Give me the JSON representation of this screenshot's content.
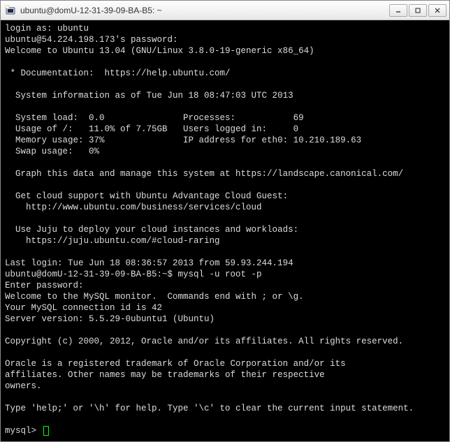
{
  "window": {
    "title": "ubuntu@domU-12-31-39-09-BA-B5: ~",
    "icon_name": "putty-icon"
  },
  "controls": {
    "minimize": "—",
    "maximize": "▢",
    "close": "✕"
  },
  "terminal": {
    "lines": [
      "login as: ubuntu",
      "ubuntu@54.224.198.173's password:",
      "Welcome to Ubuntu 13.04 (GNU/Linux 3.8.0-19-generic x86_64)",
      "",
      " * Documentation:  https://help.ubuntu.com/",
      "",
      "  System information as of Tue Jun 18 08:47:03 UTC 2013",
      "",
      "  System load:  0.0               Processes:           69",
      "  Usage of /:   11.0% of 7.75GB   Users logged in:     0",
      "  Memory usage: 37%               IP address for eth0: 10.210.189.63",
      "  Swap usage:   0%",
      "",
      "  Graph this data and manage this system at https://landscape.canonical.com/",
      "",
      "  Get cloud support with Ubuntu Advantage Cloud Guest:",
      "    http://www.ubuntu.com/business/services/cloud",
      "",
      "  Use Juju to deploy your cloud instances and workloads:",
      "    https://juju.ubuntu.com/#cloud-raring",
      "",
      "Last login: Tue Jun 18 08:36:57 2013 from 59.93.244.194",
      "ubuntu@domU-12-31-39-09-BA-B5:~$ mysql -u root -p",
      "Enter password:",
      "Welcome to the MySQL monitor.  Commands end with ; or \\g.",
      "Your MySQL connection id is 42",
      "Server version: 5.5.29-0ubuntu1 (Ubuntu)",
      "",
      "Copyright (c) 2000, 2012, Oracle and/or its affiliates. All rights reserved.",
      "",
      "Oracle is a registered trademark of Oracle Corporation and/or its",
      "affiliates. Other names may be trademarks of their respective",
      "owners.",
      "",
      "Type 'help;' or '\\h' for help. Type '\\c' to clear the current input statement.",
      "",
      "mysql>"
    ]
  }
}
